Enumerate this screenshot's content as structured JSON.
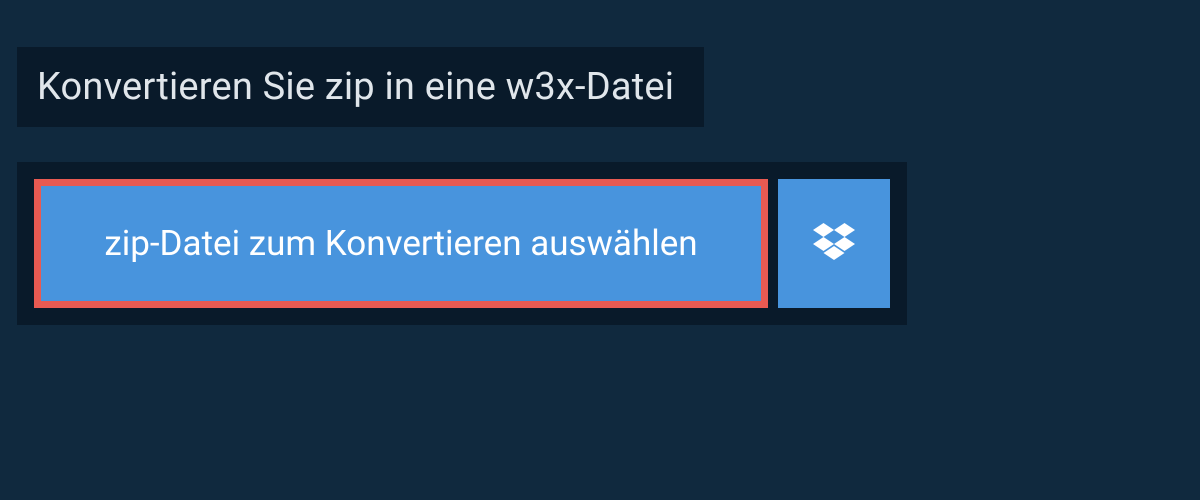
{
  "title": "Konvertieren Sie zip in eine w3x-Datei",
  "buttons": {
    "select_file_label": "zip-Datei zum Konvertieren auswählen"
  }
}
